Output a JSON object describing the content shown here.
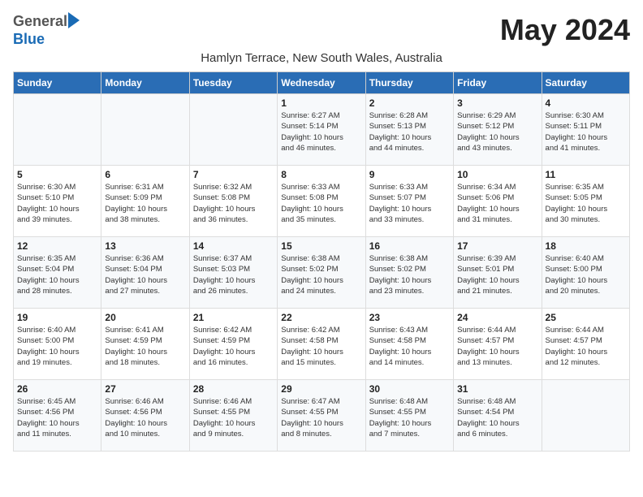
{
  "header": {
    "logo_general": "General",
    "logo_blue": "Blue",
    "month_title": "May 2024",
    "location": "Hamlyn Terrace, New South Wales, Australia"
  },
  "days_of_week": [
    "Sunday",
    "Monday",
    "Tuesday",
    "Wednesday",
    "Thursday",
    "Friday",
    "Saturday"
  ],
  "weeks": [
    [
      {
        "day": "",
        "info": ""
      },
      {
        "day": "",
        "info": ""
      },
      {
        "day": "",
        "info": ""
      },
      {
        "day": "1",
        "info": "Sunrise: 6:27 AM\nSunset: 5:14 PM\nDaylight: 10 hours\nand 46 minutes."
      },
      {
        "day": "2",
        "info": "Sunrise: 6:28 AM\nSunset: 5:13 PM\nDaylight: 10 hours\nand 44 minutes."
      },
      {
        "day": "3",
        "info": "Sunrise: 6:29 AM\nSunset: 5:12 PM\nDaylight: 10 hours\nand 43 minutes."
      },
      {
        "day": "4",
        "info": "Sunrise: 6:30 AM\nSunset: 5:11 PM\nDaylight: 10 hours\nand 41 minutes."
      }
    ],
    [
      {
        "day": "5",
        "info": "Sunrise: 6:30 AM\nSunset: 5:10 PM\nDaylight: 10 hours\nand 39 minutes."
      },
      {
        "day": "6",
        "info": "Sunrise: 6:31 AM\nSunset: 5:09 PM\nDaylight: 10 hours\nand 38 minutes."
      },
      {
        "day": "7",
        "info": "Sunrise: 6:32 AM\nSunset: 5:08 PM\nDaylight: 10 hours\nand 36 minutes."
      },
      {
        "day": "8",
        "info": "Sunrise: 6:33 AM\nSunset: 5:08 PM\nDaylight: 10 hours\nand 35 minutes."
      },
      {
        "day": "9",
        "info": "Sunrise: 6:33 AM\nSunset: 5:07 PM\nDaylight: 10 hours\nand 33 minutes."
      },
      {
        "day": "10",
        "info": "Sunrise: 6:34 AM\nSunset: 5:06 PM\nDaylight: 10 hours\nand 31 minutes."
      },
      {
        "day": "11",
        "info": "Sunrise: 6:35 AM\nSunset: 5:05 PM\nDaylight: 10 hours\nand 30 minutes."
      }
    ],
    [
      {
        "day": "12",
        "info": "Sunrise: 6:35 AM\nSunset: 5:04 PM\nDaylight: 10 hours\nand 28 minutes."
      },
      {
        "day": "13",
        "info": "Sunrise: 6:36 AM\nSunset: 5:04 PM\nDaylight: 10 hours\nand 27 minutes."
      },
      {
        "day": "14",
        "info": "Sunrise: 6:37 AM\nSunset: 5:03 PM\nDaylight: 10 hours\nand 26 minutes."
      },
      {
        "day": "15",
        "info": "Sunrise: 6:38 AM\nSunset: 5:02 PM\nDaylight: 10 hours\nand 24 minutes."
      },
      {
        "day": "16",
        "info": "Sunrise: 6:38 AM\nSunset: 5:02 PM\nDaylight: 10 hours\nand 23 minutes."
      },
      {
        "day": "17",
        "info": "Sunrise: 6:39 AM\nSunset: 5:01 PM\nDaylight: 10 hours\nand 21 minutes."
      },
      {
        "day": "18",
        "info": "Sunrise: 6:40 AM\nSunset: 5:00 PM\nDaylight: 10 hours\nand 20 minutes."
      }
    ],
    [
      {
        "day": "19",
        "info": "Sunrise: 6:40 AM\nSunset: 5:00 PM\nDaylight: 10 hours\nand 19 minutes."
      },
      {
        "day": "20",
        "info": "Sunrise: 6:41 AM\nSunset: 4:59 PM\nDaylight: 10 hours\nand 18 minutes."
      },
      {
        "day": "21",
        "info": "Sunrise: 6:42 AM\nSunset: 4:59 PM\nDaylight: 10 hours\nand 16 minutes."
      },
      {
        "day": "22",
        "info": "Sunrise: 6:42 AM\nSunset: 4:58 PM\nDaylight: 10 hours\nand 15 minutes."
      },
      {
        "day": "23",
        "info": "Sunrise: 6:43 AM\nSunset: 4:58 PM\nDaylight: 10 hours\nand 14 minutes."
      },
      {
        "day": "24",
        "info": "Sunrise: 6:44 AM\nSunset: 4:57 PM\nDaylight: 10 hours\nand 13 minutes."
      },
      {
        "day": "25",
        "info": "Sunrise: 6:44 AM\nSunset: 4:57 PM\nDaylight: 10 hours\nand 12 minutes."
      }
    ],
    [
      {
        "day": "26",
        "info": "Sunrise: 6:45 AM\nSunset: 4:56 PM\nDaylight: 10 hours\nand 11 minutes."
      },
      {
        "day": "27",
        "info": "Sunrise: 6:46 AM\nSunset: 4:56 PM\nDaylight: 10 hours\nand 10 minutes."
      },
      {
        "day": "28",
        "info": "Sunrise: 6:46 AM\nSunset: 4:55 PM\nDaylight: 10 hours\nand 9 minutes."
      },
      {
        "day": "29",
        "info": "Sunrise: 6:47 AM\nSunset: 4:55 PM\nDaylight: 10 hours\nand 8 minutes."
      },
      {
        "day": "30",
        "info": "Sunrise: 6:48 AM\nSunset: 4:55 PM\nDaylight: 10 hours\nand 7 minutes."
      },
      {
        "day": "31",
        "info": "Sunrise: 6:48 AM\nSunset: 4:54 PM\nDaylight: 10 hours\nand 6 minutes."
      },
      {
        "day": "",
        "info": ""
      }
    ]
  ]
}
